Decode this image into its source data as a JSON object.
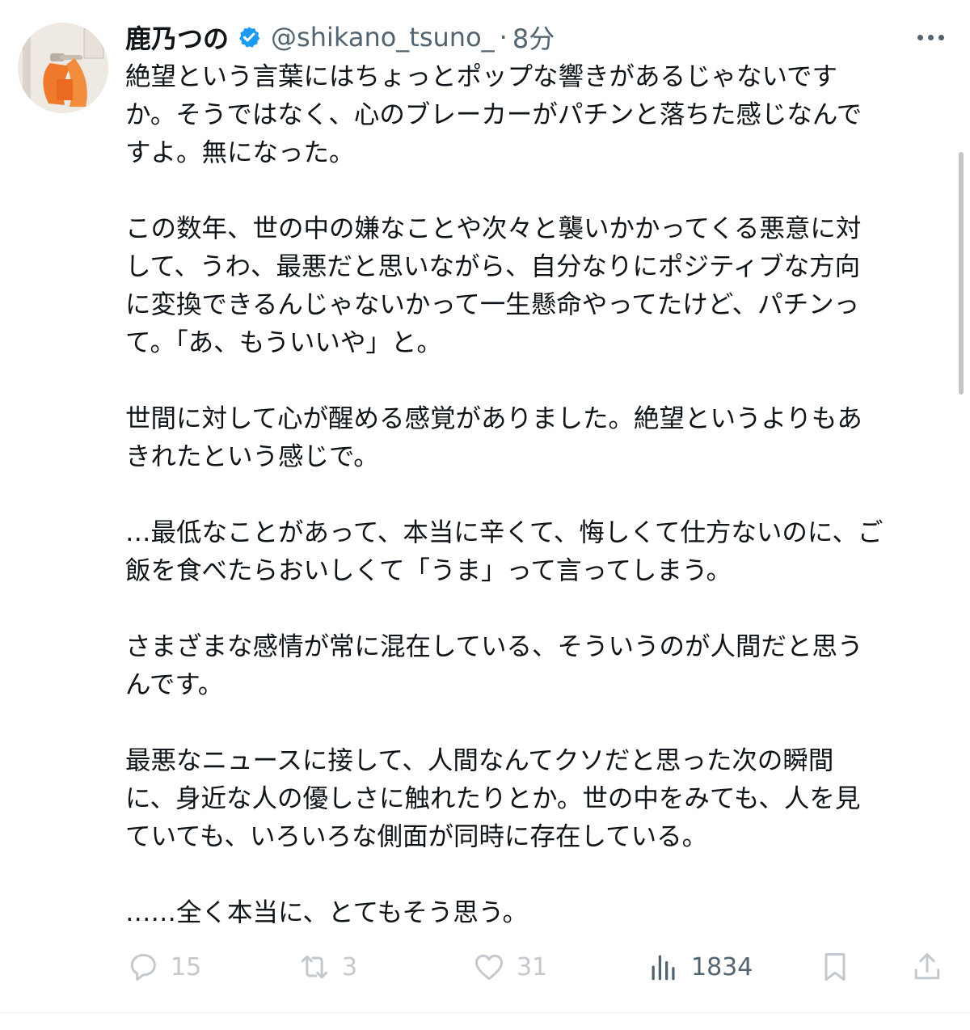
{
  "tweet": {
    "display_name": "鹿乃つの",
    "handle": "@shikano_tsuno_",
    "separator": "·",
    "time": "8分",
    "paragraphs": [
      "絶望という言葉にはちょっとポップな響きがあるじゃないです\nか。そうではなく、心のブレーカーがパチンと落ちた感じなんで\nすよ。無になった。",
      "この数年、世の中の嫌なことや次々と襲いかかってくる悪意に対\nして、うわ、最悪だと思いながら、自分なりにポジティブな方向\nに変換できるんじゃないかって一生懸命やってたけど、パチンっ\nて。「あ、もういいや」と。",
      "世間に対して心が醒める感覚がありました。絶望というよりもあ\nきれたという感じで。",
      "…最低なことがあって、本当に辛くて、悔しくて仕方ないのに、ご\n飯を食べたらおいしくて「うま」って言ってしまう。",
      "さまざまな感情が常に混在している、そういうのが人間だと思う\nんです。",
      "最悪なニュースに接して、人間なんてクソだと思った次の瞬間\nに、身近な人の優しさに触れたりとか。世の中をみても、人を見\nていても、いろいろな側面が同時に存在している。",
      "……全く本当に、とてもそう思う。"
    ]
  },
  "actions": {
    "reply_count": "15",
    "retweet_count": "3",
    "like_count": "31",
    "views_count": "1834"
  },
  "icons": {
    "verified": "verified-badge-icon",
    "more": "more-icon",
    "reply": "reply-icon",
    "retweet": "retweet-icon",
    "like": "like-icon",
    "views": "views-icon",
    "bookmark": "bookmark-icon",
    "share": "share-icon"
  },
  "colors": {
    "text": "#0f1419",
    "secondary": "#536471",
    "verified": "#1d9bf0",
    "avatar_accent": "#f07a2c"
  }
}
